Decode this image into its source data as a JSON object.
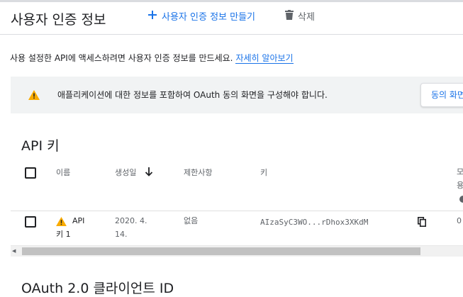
{
  "header": {
    "title": "사용자 인증 정보",
    "create_label": "사용자 인증 정보 만들기",
    "delete_label": "삭제"
  },
  "intro": {
    "text": "사용 설정한 API에 액세스하려면 사용자 인증 정보를 만드세요.",
    "link": "자세히 알아보기"
  },
  "banner": {
    "text": "애플리케이션에 대한 정보를 포함하여 OAuth 동의 화면을 구성해야 합니다.",
    "button": "동의 화면"
  },
  "api_keys": {
    "title": "API 키",
    "columns": {
      "name": "이름",
      "created": "생성일",
      "restrictions": "제한사항",
      "key": "키",
      "extra": "모\n용"
    },
    "rows": [
      {
        "name": "API\n키 1",
        "created": "2020. 4.\n14.",
        "restrictions": "없음",
        "key": "AIzaSyC3WO...rDhox3XKdM",
        "extra": "0"
      }
    ]
  },
  "oauth": {
    "title": "OAuth 2.0 클라이언트 ID"
  },
  "colors": {
    "accent": "#1a73e8",
    "warning": "#f9ab00",
    "banner_bg": "#f1f3f4"
  },
  "icons": {
    "create": "plus-icon",
    "delete": "trash-icon",
    "warning": "warning-icon",
    "sort": "arrow-down-icon",
    "copy": "copy-icon"
  }
}
